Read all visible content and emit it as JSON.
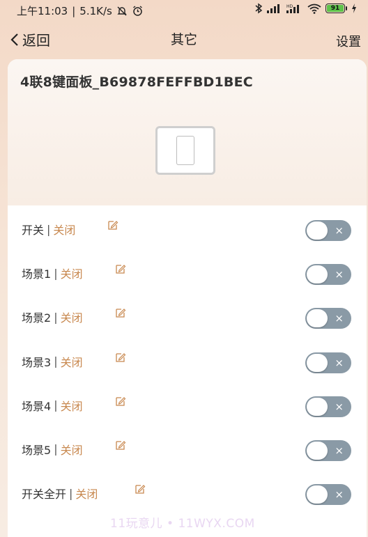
{
  "status_bar": {
    "time": "上午11:03",
    "speed": "5.1K/s",
    "battery_level": "91"
  },
  "nav": {
    "back_label": "返回",
    "title": "其它",
    "settings_label": "设置"
  },
  "device": {
    "name": "4联8键面板_B69878FEFFBD1BEC"
  },
  "switches": [
    {
      "label": "开关",
      "state": "关闭",
      "on": false
    },
    {
      "label": "场景1",
      "state": "关闭",
      "on": false
    },
    {
      "label": "场景2",
      "state": "关闭",
      "on": false
    },
    {
      "label": "场景3",
      "state": "关闭",
      "on": false
    },
    {
      "label": "场景4",
      "state": "关闭",
      "on": false
    },
    {
      "label": "场景5",
      "state": "关闭",
      "on": false
    },
    {
      "label": "开关全开",
      "state": "关闭",
      "on": false
    }
  ],
  "separator": "|",
  "toggle_off_symbol": "×",
  "watermark": "11玩意儿 • 11WYX.COM",
  "colors": {
    "state_text": "#c8884f",
    "toggle_off": "#8a9aa6",
    "battery": "#5ec34a"
  }
}
